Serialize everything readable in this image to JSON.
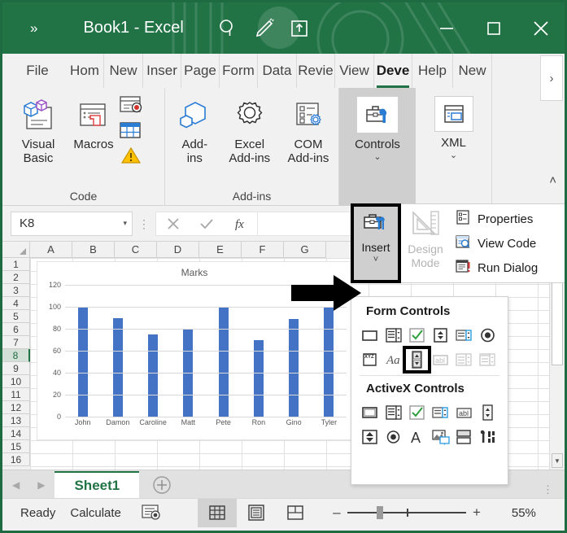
{
  "titlebar": {
    "qat_more": "»",
    "title": "Book1  -  Excel",
    "icons": [
      "search-icon",
      "pen-icon",
      "share-icon"
    ],
    "minimize": "–",
    "maximize": "□",
    "close": "✕"
  },
  "tabs": [
    {
      "label": "File",
      "active": false
    },
    {
      "label": "Hom",
      "active": false
    },
    {
      "label": "New",
      "active": false
    },
    {
      "label": "Inser",
      "active": false
    },
    {
      "label": "Page",
      "active": false
    },
    {
      "label": "Form",
      "active": false
    },
    {
      "label": "Data",
      "active": false
    },
    {
      "label": "Revie",
      "active": false
    },
    {
      "label": "View",
      "active": false
    },
    {
      "label": "Deve",
      "active": true
    },
    {
      "label": "Help",
      "active": false
    },
    {
      "label": "New",
      "active": false
    }
  ],
  "tabs_overflow": "›",
  "ribbon": {
    "groups": [
      {
        "name": "Code",
        "label": "Code",
        "buttons": [
          {
            "label_line1": "Visual",
            "label_line2": "Basic",
            "icon": "visual-basic-icon"
          },
          {
            "label_line1": "Macros",
            "label_line2": "",
            "icon": "macros-icon"
          }
        ],
        "small_icons": [
          "record-macro-icon",
          "use-relative-references-icon",
          "macro-security-icon"
        ]
      },
      {
        "name": "Add-ins",
        "label": "Add-ins",
        "buttons": [
          {
            "label_line1": "Add-",
            "label_line2": "ins",
            "icon": "addins-icon"
          },
          {
            "label_line1": "Excel",
            "label_line2": "Add-ins",
            "icon": "excel-addins-icon"
          },
          {
            "label_line1": "COM",
            "label_line2": "Add-ins",
            "icon": "com-addins-icon"
          }
        ]
      },
      {
        "name": "Controls",
        "label": "",
        "buttons": [
          {
            "label_line1": "Controls",
            "label_line2": "",
            "icon": "controls-icon"
          }
        ],
        "highlighted": true
      },
      {
        "name": "XML",
        "label": "",
        "buttons": [
          {
            "label_line1": "XML",
            "label_line2": "",
            "icon": "xml-icon"
          }
        ]
      }
    ],
    "collapse_label": "˄"
  },
  "formula_bar": {
    "name_box_value": "K8",
    "name_box_arrow": "▾",
    "cancel_icon": "cancel-icon",
    "enter_icon": "enter-icon",
    "function_icon": "insert-function-icon",
    "formula_value": ""
  },
  "grid": {
    "columns": [
      "A",
      "B",
      "C",
      "D",
      "E",
      "F",
      "G"
    ],
    "rows": [
      1,
      2,
      3,
      4,
      5,
      6,
      7,
      8,
      9,
      10,
      11,
      12,
      13,
      14,
      15,
      16
    ],
    "selected_row": 8
  },
  "chart_data": {
    "type": "bar",
    "title": "Marks",
    "categories": [
      "John",
      "Damon",
      "Caroline",
      "Matt",
      "Pete",
      "Ron",
      "Gino",
      "Tyler"
    ],
    "values": [
      100,
      90,
      75,
      80,
      100,
      70,
      89,
      99
    ],
    "ylabel": "",
    "xlabel": "",
    "ylim": [
      0,
      120
    ],
    "yticks": [
      0,
      20,
      40,
      60,
      80,
      100,
      120
    ],
    "grid": true,
    "legend": false,
    "bar_color": "#4472c4"
  },
  "insert_menu": {
    "insert_button": {
      "label": "Insert",
      "chevron": "˅",
      "icon": "insert-controls-icon"
    },
    "design_mode": {
      "line1": "Design",
      "line2": "Mode",
      "icon": "design-mode-icon",
      "disabled": true
    },
    "items": [
      {
        "label": "Properties",
        "icon": "properties-icon"
      },
      {
        "label": "View Code",
        "icon": "view-code-icon"
      },
      {
        "label": "Run Dialog",
        "icon": "run-dialog-icon"
      }
    ]
  },
  "controls_panel": {
    "form_controls": {
      "heading": "Form Controls",
      "row1": [
        {
          "name": "button-control",
          "disabled": false
        },
        {
          "name": "combo-box-control",
          "disabled": false
        },
        {
          "name": "check-box-control",
          "disabled": false
        },
        {
          "name": "spin-button-control",
          "disabled": false
        },
        {
          "name": "list-box-control",
          "disabled": false
        },
        {
          "name": "option-button-control",
          "disabled": false
        }
      ],
      "row2": [
        {
          "name": "group-box-control",
          "disabled": false
        },
        {
          "name": "label-control",
          "disabled": false
        },
        {
          "name": "scroll-bar-control",
          "disabled": false,
          "highlighted": true
        },
        {
          "name": "text-field-control",
          "disabled": true
        },
        {
          "name": "list-box-alt-control",
          "disabled": true
        },
        {
          "name": "combo-box-alt-control",
          "disabled": true
        }
      ]
    },
    "activex_controls": {
      "heading": "ActiveX Controls",
      "row1": [
        {
          "name": "command-button-control"
        },
        {
          "name": "combo-box-control"
        },
        {
          "name": "check-box-control"
        },
        {
          "name": "list-box-control"
        },
        {
          "name": "text-box-control"
        },
        {
          "name": "spin-button-control"
        }
      ],
      "row2": [
        {
          "name": "scroll-bar-control"
        },
        {
          "name": "option-button-control"
        },
        {
          "name": "label-control"
        },
        {
          "name": "image-control"
        },
        {
          "name": "toggle-button-control"
        },
        {
          "name": "more-controls-control"
        }
      ]
    }
  },
  "sheet_bar": {
    "prev_arrow": "◀",
    "next_arrow": "▶",
    "tabs": [
      {
        "label": "Sheet1",
        "active": true
      }
    ],
    "add_sheet": "+",
    "dots": "⋮"
  },
  "status_bar": {
    "mode": "Ready",
    "calculate": "Calculate",
    "macro_icon": "record-macro-icon",
    "views": [
      {
        "name": "normal-view",
        "active": true
      },
      {
        "name": "page-layout-view",
        "active": false
      },
      {
        "name": "page-break-preview",
        "active": false
      }
    ],
    "zoom_out": "–",
    "zoom_in": "+",
    "zoom_percent": "55%"
  }
}
